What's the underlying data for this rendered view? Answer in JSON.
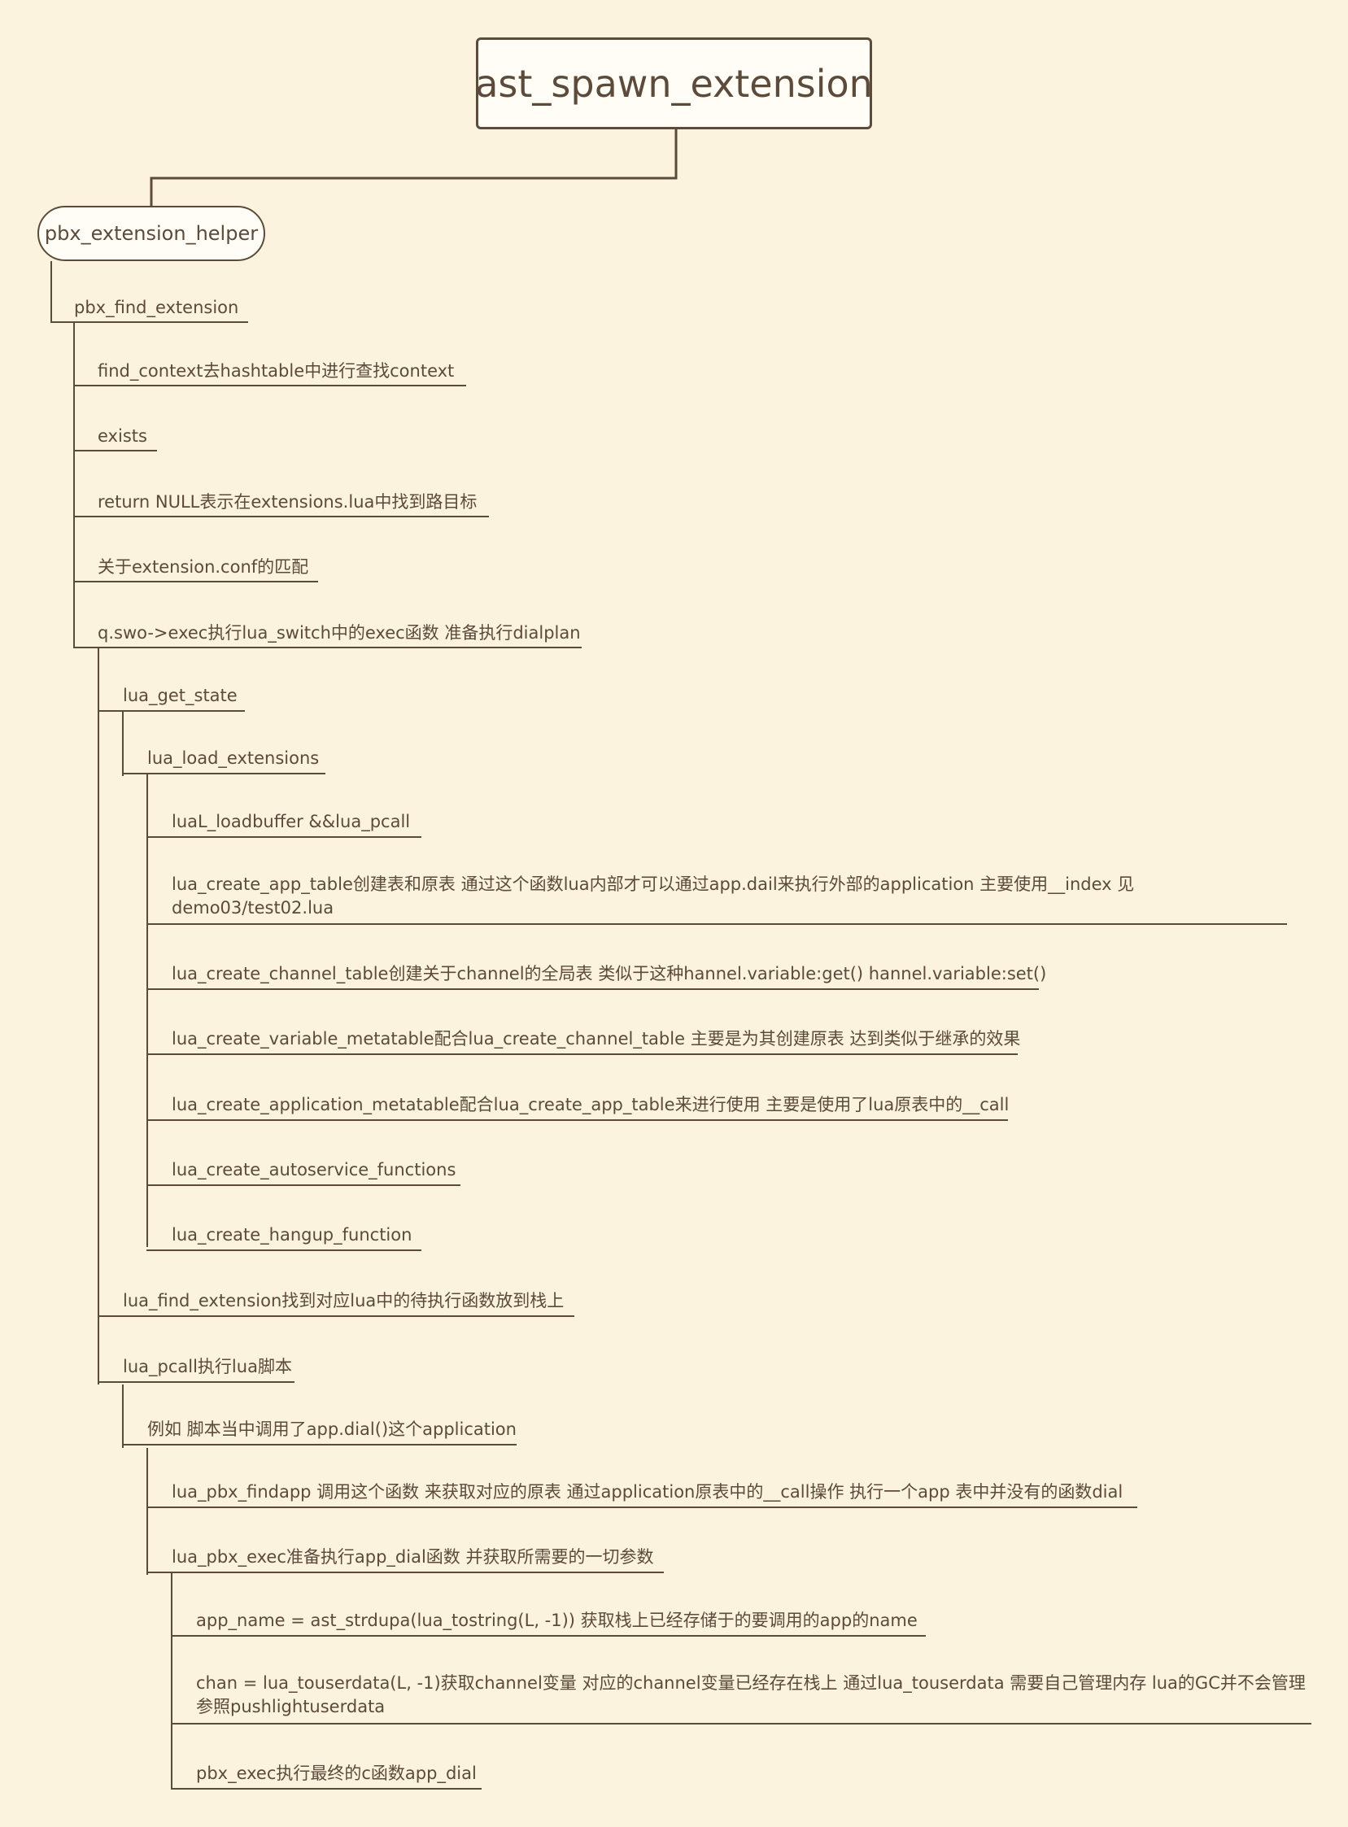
{
  "root": {
    "label": "ast_spawn_extension"
  },
  "helper": {
    "label": "pbx_extension_helper"
  },
  "nodes": [
    {
      "id": "n-pbx-find-extension",
      "text": "pbx_find_extension"
    },
    {
      "id": "n-find-context",
      "text": "find_context去hashtable中进行查找context"
    },
    {
      "id": "n-exists",
      "text": "exists"
    },
    {
      "id": "n-return-null",
      "text": "return NULL表示在extensions.lua中找到路目标"
    },
    {
      "id": "n-extension-conf",
      "text": "关于extension.conf的匹配"
    },
    {
      "id": "n-swo-exec",
      "text": "q.swo->exec执行lua_switch中的exec函数 准备执行dialplan"
    },
    {
      "id": "n-lua-get-state",
      "text": "lua_get_state"
    },
    {
      "id": "n-lua-load-extensions",
      "text": "lua_load_extensions"
    },
    {
      "id": "n-loadbuffer",
      "text": "luaL_loadbuffer &&lua_pcall"
    },
    {
      "id": "n-create-app-table",
      "text": "lua_create_app_table创建表和原表 通过这个函数lua内部才可以通过app.dail来执行外部的application 主要使用__index  见demo03/test02.lua"
    },
    {
      "id": "n-create-channel-table",
      "text": "lua_create_channel_table创建关于channel的全局表 类似于这种hannel.variable:get() hannel.variable:set()"
    },
    {
      "id": "n-create-variable-metatable",
      "text": "lua_create_variable_metatable配合lua_create_channel_table 主要是为其创建原表 达到类似于继承的效果"
    },
    {
      "id": "n-create-application-metatable",
      "text": "lua_create_application_metatable配合lua_create_app_table来进行使用 主要是使用了lua原表中的__call"
    },
    {
      "id": "n-create-autoservice",
      "text": "lua_create_autoservice_functions"
    },
    {
      "id": "n-create-hangup",
      "text": "lua_create_hangup_function"
    },
    {
      "id": "n-lua-find-extension",
      "text": "lua_find_extension找到对应lua中的待执行函数放到栈上"
    },
    {
      "id": "n-lua-pcall",
      "text": "lua_pcall执行lua脚本"
    },
    {
      "id": "n-example-app-dial",
      "text": "例如 脚本当中调用了app.dial()这个application"
    },
    {
      "id": "n-lua-pbx-findapp",
      "text": "lua_pbx_findapp 调用这个函数 来获取对应的原表 通过application原表中的__call操作 执行一个app 表中并没有的函数dial"
    },
    {
      "id": "n-lua-pbx-exec",
      "text": "lua_pbx_exec准备执行app_dial函数 并获取所需要的一切参数"
    },
    {
      "id": "n-app-name",
      "text": "app_name = ast_strdupa(lua_tostring(L, -1)) 获取栈上已经存储于的要调用的app的name"
    },
    {
      "id": "n-chan",
      "text": "chan = lua_touserdata(L, -1)获取channel变量 对应的channel变量已经存在栈上 通过lua_touserdata 需要自己管理内存 lua的GC并不会管理参照pushlightuserdata"
    },
    {
      "id": "n-pbx-exec",
      "text": "pbx_exec执行最终的c函数app_dial"
    }
  ]
}
